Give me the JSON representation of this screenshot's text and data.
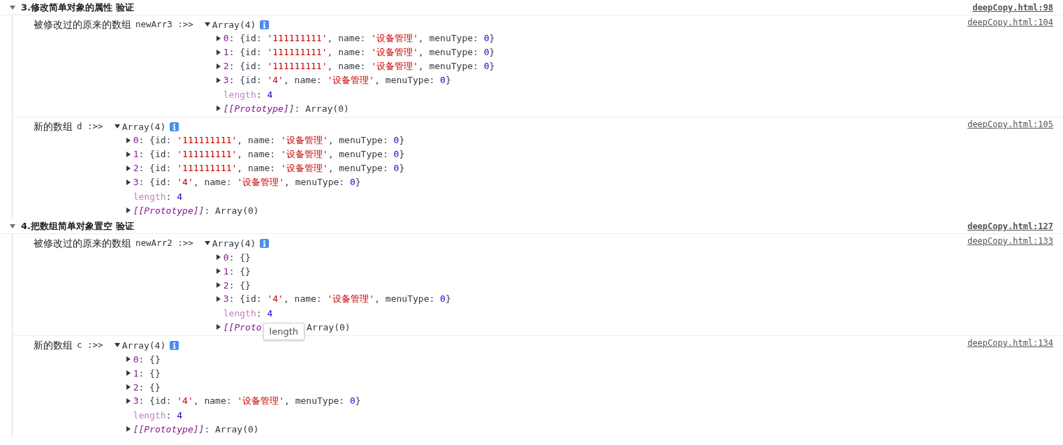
{
  "groups": [
    {
      "title": "3.修改简单对象的属性 验证",
      "expanded": true,
      "source": "deepCopy.html:98",
      "entries": [
        {
          "label": "被修改过的原来的数组",
          "variable": "newArr3 :>>",
          "source": "deepCopy.html:104",
          "array": {
            "summary": "Array(4)",
            "expanded": true,
            "rows": [
              {
                "expandable": true,
                "expanded": false,
                "tokens": [
                  {
                    "text": "0",
                    "kind": "index"
                  },
                  {
                    "text": ": {id: ",
                    "kind": "plain"
                  },
                  {
                    "text": "'111111111'",
                    "kind": "string"
                  },
                  {
                    "text": ", name: ",
                    "kind": "plain"
                  },
                  {
                    "text": "'设备管理'",
                    "kind": "string"
                  },
                  {
                    "text": ", menuType: ",
                    "kind": "plain"
                  },
                  {
                    "text": "0",
                    "kind": "number"
                  },
                  {
                    "text": "}",
                    "kind": "plain"
                  }
                ]
              },
              {
                "expandable": true,
                "expanded": false,
                "tokens": [
                  {
                    "text": "1",
                    "kind": "index"
                  },
                  {
                    "text": ": {id: ",
                    "kind": "plain"
                  },
                  {
                    "text": "'111111111'",
                    "kind": "string"
                  },
                  {
                    "text": ", name: ",
                    "kind": "plain"
                  },
                  {
                    "text": "'设备管理'",
                    "kind": "string"
                  },
                  {
                    "text": ", menuType: ",
                    "kind": "plain"
                  },
                  {
                    "text": "0",
                    "kind": "number"
                  },
                  {
                    "text": "}",
                    "kind": "plain"
                  }
                ]
              },
              {
                "expandable": true,
                "expanded": false,
                "tokens": [
                  {
                    "text": "2",
                    "kind": "index"
                  },
                  {
                    "text": ": {id: ",
                    "kind": "plain"
                  },
                  {
                    "text": "'111111111'",
                    "kind": "string"
                  },
                  {
                    "text": ", name: ",
                    "kind": "plain"
                  },
                  {
                    "text": "'设备管理'",
                    "kind": "string"
                  },
                  {
                    "text": ", menuType: ",
                    "kind": "plain"
                  },
                  {
                    "text": "0",
                    "kind": "number"
                  },
                  {
                    "text": "}",
                    "kind": "plain"
                  }
                ]
              },
              {
                "expandable": true,
                "expanded": false,
                "tokens": [
                  {
                    "text": "3",
                    "kind": "index"
                  },
                  {
                    "text": ": {id: ",
                    "kind": "plain"
                  },
                  {
                    "text": "'4'",
                    "kind": "string"
                  },
                  {
                    "text": ", name: ",
                    "kind": "plain"
                  },
                  {
                    "text": "'设备管理'",
                    "kind": "string"
                  },
                  {
                    "text": ", menuType: ",
                    "kind": "plain"
                  },
                  {
                    "text": "0",
                    "kind": "number"
                  },
                  {
                    "text": "}",
                    "kind": "plain"
                  }
                ]
              },
              {
                "expandable": false,
                "tokens": [
                  {
                    "text": "length",
                    "kind": "dim"
                  },
                  {
                    "text": ": ",
                    "kind": "plain"
                  },
                  {
                    "text": "4",
                    "kind": "number"
                  }
                ]
              },
              {
                "expandable": true,
                "expanded": false,
                "tokens": [
                  {
                    "text": "[[Prototype]]",
                    "kind": "internal"
                  },
                  {
                    "text": ": Array(0)",
                    "kind": "plain"
                  }
                ]
              }
            ]
          }
        },
        {
          "label": "新的数组",
          "variable": "d :>>",
          "source": "deepCopy.html:105",
          "array": {
            "summary": "Array(4)",
            "expanded": true,
            "rows": [
              {
                "expandable": true,
                "expanded": false,
                "tokens": [
                  {
                    "text": "0",
                    "kind": "index"
                  },
                  {
                    "text": ": {id: ",
                    "kind": "plain"
                  },
                  {
                    "text": "'111111111'",
                    "kind": "string"
                  },
                  {
                    "text": ", name: ",
                    "kind": "plain"
                  },
                  {
                    "text": "'设备管理'",
                    "kind": "string"
                  },
                  {
                    "text": ", menuType: ",
                    "kind": "plain"
                  },
                  {
                    "text": "0",
                    "kind": "number"
                  },
                  {
                    "text": "}",
                    "kind": "plain"
                  }
                ]
              },
              {
                "expandable": true,
                "expanded": false,
                "tokens": [
                  {
                    "text": "1",
                    "kind": "index"
                  },
                  {
                    "text": ": {id: ",
                    "kind": "plain"
                  },
                  {
                    "text": "'111111111'",
                    "kind": "string"
                  },
                  {
                    "text": ", name: ",
                    "kind": "plain"
                  },
                  {
                    "text": "'设备管理'",
                    "kind": "string"
                  },
                  {
                    "text": ", menuType: ",
                    "kind": "plain"
                  },
                  {
                    "text": "0",
                    "kind": "number"
                  },
                  {
                    "text": "}",
                    "kind": "plain"
                  }
                ]
              },
              {
                "expandable": true,
                "expanded": false,
                "tokens": [
                  {
                    "text": "2",
                    "kind": "index"
                  },
                  {
                    "text": ": {id: ",
                    "kind": "plain"
                  },
                  {
                    "text": "'111111111'",
                    "kind": "string"
                  },
                  {
                    "text": ", name: ",
                    "kind": "plain"
                  },
                  {
                    "text": "'设备管理'",
                    "kind": "string"
                  },
                  {
                    "text": ", menuType: ",
                    "kind": "plain"
                  },
                  {
                    "text": "0",
                    "kind": "number"
                  },
                  {
                    "text": "}",
                    "kind": "plain"
                  }
                ]
              },
              {
                "expandable": true,
                "expanded": false,
                "tokens": [
                  {
                    "text": "3",
                    "kind": "index"
                  },
                  {
                    "text": ": {id: ",
                    "kind": "plain"
                  },
                  {
                    "text": "'4'",
                    "kind": "string"
                  },
                  {
                    "text": ", name: ",
                    "kind": "plain"
                  },
                  {
                    "text": "'设备管理'",
                    "kind": "string"
                  },
                  {
                    "text": ", menuType: ",
                    "kind": "plain"
                  },
                  {
                    "text": "0",
                    "kind": "number"
                  },
                  {
                    "text": "}",
                    "kind": "plain"
                  }
                ]
              },
              {
                "expandable": false,
                "tokens": [
                  {
                    "text": "length",
                    "kind": "dim"
                  },
                  {
                    "text": ": ",
                    "kind": "plain"
                  },
                  {
                    "text": "4",
                    "kind": "number"
                  }
                ]
              },
              {
                "expandable": true,
                "expanded": false,
                "tokens": [
                  {
                    "text": "[[Prototype]]",
                    "kind": "internal"
                  },
                  {
                    "text": ": Array(0)",
                    "kind": "plain"
                  }
                ]
              }
            ]
          }
        }
      ]
    },
    {
      "title": "4.把数组简单对象置空 验证",
      "expanded": true,
      "source": "deepCopy.html:127",
      "entries": [
        {
          "label": "被修改过的原来的数组",
          "variable": "newArr2 :>>",
          "source": "deepCopy.html:133",
          "array": {
            "summary": "Array(4)",
            "expanded": true,
            "rows": [
              {
                "expandable": true,
                "expanded": false,
                "tokens": [
                  {
                    "text": "0",
                    "kind": "index"
                  },
                  {
                    "text": ": {}",
                    "kind": "plain"
                  }
                ]
              },
              {
                "expandable": true,
                "expanded": false,
                "tokens": [
                  {
                    "text": "1",
                    "kind": "index"
                  },
                  {
                    "text": ": {}",
                    "kind": "plain"
                  }
                ]
              },
              {
                "expandable": true,
                "expanded": false,
                "tokens": [
                  {
                    "text": "2",
                    "kind": "index"
                  },
                  {
                    "text": ": {}",
                    "kind": "plain"
                  }
                ]
              },
              {
                "expandable": true,
                "expanded": false,
                "tokens": [
                  {
                    "text": "3",
                    "kind": "index"
                  },
                  {
                    "text": ": {id: ",
                    "kind": "plain"
                  },
                  {
                    "text": "'4'",
                    "kind": "string"
                  },
                  {
                    "text": ", name: ",
                    "kind": "plain"
                  },
                  {
                    "text": "'设备管理'",
                    "kind": "string"
                  },
                  {
                    "text": ", menuType: ",
                    "kind": "plain"
                  },
                  {
                    "text": "0",
                    "kind": "number"
                  },
                  {
                    "text": "}",
                    "kind": "plain"
                  }
                ]
              },
              {
                "expandable": false,
                "tokens": [
                  {
                    "text": "length",
                    "kind": "dim"
                  },
                  {
                    "text": ": ",
                    "kind": "plain"
                  },
                  {
                    "text": "4",
                    "kind": "number"
                  }
                ]
              },
              {
                "expandable": true,
                "expanded": false,
                "tokens": [
                  {
                    "text": "[[Proto",
                    "kind": "internal"
                  },
                  {
                    "text": "length",
                    "kind": "tooltip"
                  },
                  {
                    "text": "Array(0)",
                    "kind": "plain"
                  }
                ]
              }
            ]
          }
        },
        {
          "label": "新的数组",
          "variable": "c :>>",
          "source": "deepCopy.html:134",
          "array": {
            "summary": "Array(4)",
            "expanded": true,
            "rows": [
              {
                "expandable": true,
                "expanded": false,
                "tokens": [
                  {
                    "text": "0",
                    "kind": "index"
                  },
                  {
                    "text": ": {}",
                    "kind": "plain"
                  }
                ]
              },
              {
                "expandable": true,
                "expanded": false,
                "tokens": [
                  {
                    "text": "1",
                    "kind": "index"
                  },
                  {
                    "text": ": {}",
                    "kind": "plain"
                  }
                ]
              },
              {
                "expandable": true,
                "expanded": false,
                "tokens": [
                  {
                    "text": "2",
                    "kind": "index"
                  },
                  {
                    "text": ": {}",
                    "kind": "plain"
                  }
                ]
              },
              {
                "expandable": true,
                "expanded": false,
                "tokens": [
                  {
                    "text": "3",
                    "kind": "index"
                  },
                  {
                    "text": ": {id: ",
                    "kind": "plain"
                  },
                  {
                    "text": "'4'",
                    "kind": "string"
                  },
                  {
                    "text": ", name: ",
                    "kind": "plain"
                  },
                  {
                    "text": "'设备管理'",
                    "kind": "string"
                  },
                  {
                    "text": ", menuType: ",
                    "kind": "plain"
                  },
                  {
                    "text": "0",
                    "kind": "number"
                  },
                  {
                    "text": "}",
                    "kind": "plain"
                  }
                ]
              },
              {
                "expandable": false,
                "tokens": [
                  {
                    "text": "length",
                    "kind": "dim"
                  },
                  {
                    "text": ": ",
                    "kind": "plain"
                  },
                  {
                    "text": "4",
                    "kind": "number"
                  }
                ]
              },
              {
                "expandable": true,
                "expanded": false,
                "tokens": [
                  {
                    "text": "[[Prototype]]",
                    "kind": "internal"
                  },
                  {
                    "text": ": Array(0)",
                    "kind": "plain"
                  }
                ]
              }
            ]
          }
        }
      ]
    }
  ]
}
